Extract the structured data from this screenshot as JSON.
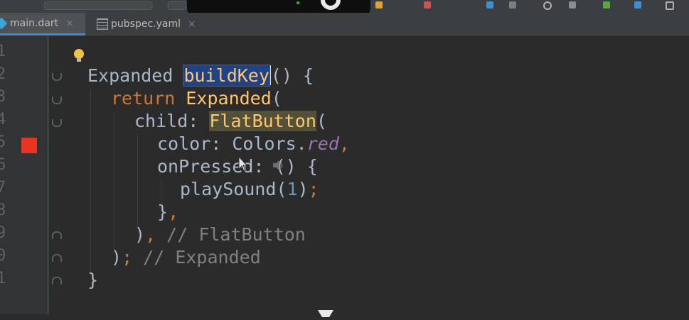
{
  "tabs": [
    {
      "label": "main.dart",
      "close": "×",
      "active": true,
      "icon": "dart-file-icon"
    },
    {
      "label": "pubspec.yaml",
      "close": "×",
      "active": false,
      "icon": "yaml-file-icon"
    }
  ],
  "line_numbers": [
    "1",
    "2",
    "3",
    "4",
    "5",
    "6",
    "7",
    "8",
    "9",
    "0",
    "1"
  ],
  "code": {
    "l2": {
      "type": "Expanded",
      "name": "buildKey",
      "rest": "() {"
    },
    "l3": {
      "kw": "return",
      "cls": "Expanded",
      "rest": "("
    },
    "l4": {
      "prop": "child: ",
      "cls": "FlatButton",
      "rest": "("
    },
    "l5": {
      "prop": "color: Colors.",
      "val": "red",
      "comma": ","
    },
    "l6": {
      "prop": "onPressed: () {"
    },
    "l7": {
      "fn": "playSound(",
      "num": "1",
      "rest": ")",
      "semi": ";"
    },
    "l8": {
      "brace": "}",
      "comma": ","
    },
    "l9": {
      "paren": ")",
      "comma": ",",
      "comment": " // FlatButton"
    },
    "l10": {
      "paren": ")",
      "semi": ";",
      "comment": " // Expanded"
    },
    "l11": {
      "brace": "}"
    }
  },
  "colors": {
    "background": "#2b2b2b",
    "keyword": "#cc7832",
    "class": "#ffc66d",
    "comment": "#808080",
    "breakpoint": "#ea3323",
    "selection": "#214283"
  }
}
